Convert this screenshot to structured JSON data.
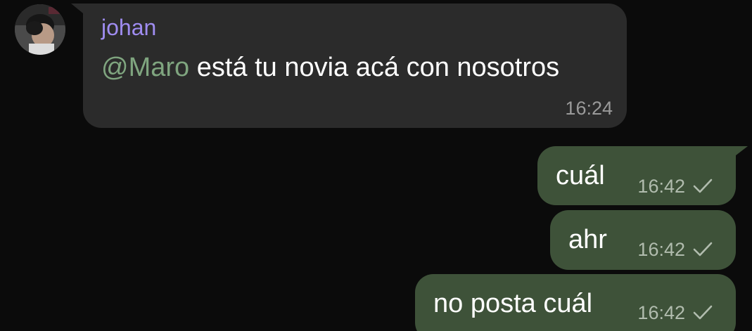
{
  "incoming": {
    "sender": "johan",
    "mention": "@Maro",
    "text": " está tu novia acá con nosotros",
    "time": "16:24"
  },
  "outgoing": [
    {
      "text": "cuál",
      "time": "16:42",
      "status": "sent-check-icon"
    },
    {
      "text": "ahr",
      "time": "16:42",
      "status": "sent-check-icon"
    },
    {
      "text": "no posta cuál",
      "time": "16:42",
      "status": "sent-check-icon"
    }
  ],
  "colors": {
    "background": "#0b0b0b",
    "incoming_bubble": "#2b2b2b",
    "outgoing_bubble": "#3e5239",
    "sender_name": "#9f8cf0",
    "mention": "#7fa57f"
  }
}
